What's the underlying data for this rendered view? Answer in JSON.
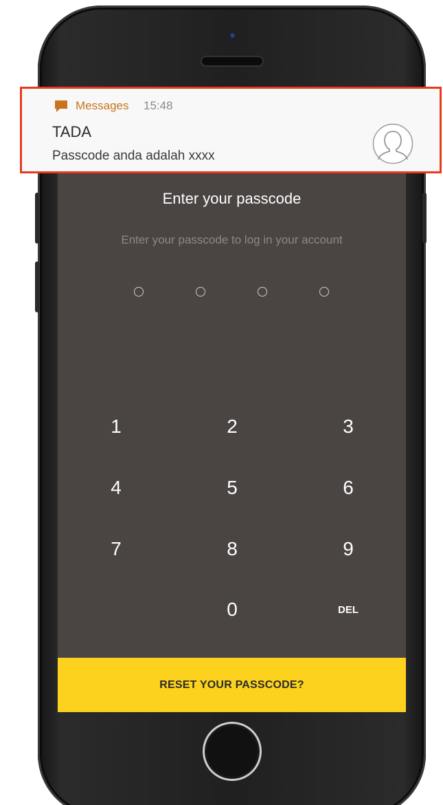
{
  "notification": {
    "app_name": "Messages",
    "time": "15:48",
    "title": "TADA",
    "body": "Passcode anda adalah xxxx",
    "icon": "message-bubble-icon",
    "avatar_icon": "contact-avatar-icon",
    "highlight_color": "#e8391d",
    "app_color": "#c8741d"
  },
  "passcode": {
    "title": "Enter your passcode",
    "subtitle": "Enter your passcode to log in your account",
    "entered_digits": 0,
    "total_digits": 4
  },
  "keypad": {
    "keys": [
      "1",
      "2",
      "3",
      "4",
      "5",
      "6",
      "7",
      "8",
      "9",
      "0",
      "DEL"
    ]
  },
  "reset": {
    "label": "RESET YOUR PASSCODE?",
    "color": "#fdd21e"
  },
  "colors": {
    "screen_background": "#4a4543",
    "device_body": "#202021"
  }
}
